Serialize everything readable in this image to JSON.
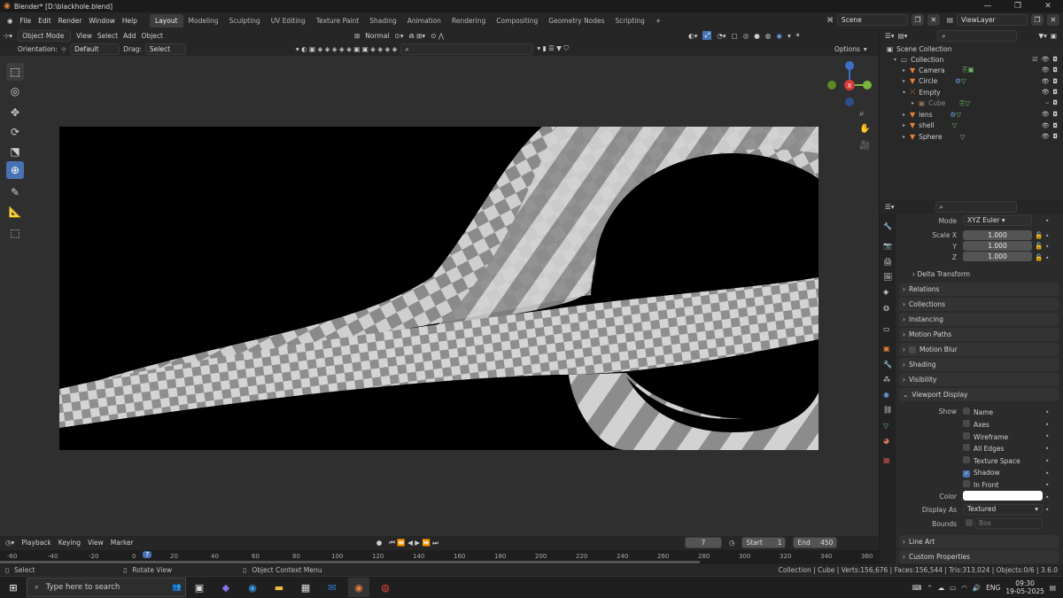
{
  "window": {
    "title": "Blender* [D:\\blackhole.blend]"
  },
  "menu": [
    "File",
    "Edit",
    "Render",
    "Window",
    "Help"
  ],
  "workspaces": [
    "Layout",
    "Modeling",
    "Sculpting",
    "UV Editing",
    "Texture Paint",
    "Shading",
    "Animation",
    "Rendering",
    "Compositing",
    "Geometry Nodes",
    "Scripting"
  ],
  "scene": {
    "name": "Scene",
    "view_layer": "ViewLayer"
  },
  "viewport_header": {
    "mode": "Object Mode",
    "menus": [
      "View",
      "Select",
      "Add",
      "Object"
    ],
    "transform": "Normal",
    "options": "Options"
  },
  "toolsettings": {
    "orientation_label": "Orientation:",
    "orientation": "Default",
    "drag_label": "Drag:",
    "drag": "Select Box"
  },
  "outliner": {
    "root": "Scene Collection",
    "collection": "Collection",
    "items": [
      "Camera",
      "Circle",
      "Empty",
      "Cube",
      "lens",
      "shell",
      "Sphere"
    ]
  },
  "properties": {
    "mode_label": "Mode",
    "mode": "XYZ Euler",
    "scale_label": "Scale X",
    "scale": {
      "x": "1.000",
      "y": "1.000",
      "z": "1.000"
    },
    "axis_y": "Y",
    "axis_z": "Z",
    "panels": [
      "Delta Transform",
      "Relations",
      "Collections",
      "Instancing",
      "Motion Paths",
      "Motion Blur",
      "Shading",
      "Visibility",
      "Viewport Display"
    ],
    "show_label": "Show",
    "show": [
      {
        "label": "Name",
        "on": false
      },
      {
        "label": "Axes",
        "on": false
      },
      {
        "label": "Wireframe",
        "on": false
      },
      {
        "label": "All Edges",
        "on": false
      },
      {
        "label": "Texture Space",
        "on": false
      },
      {
        "label": "Shadow",
        "on": true
      },
      {
        "label": "In Front",
        "on": false
      }
    ],
    "color_label": "Color",
    "display_as_label": "Display As",
    "display_as": "Textured",
    "bounds_label": "Bounds",
    "bounds": "Box",
    "bottom_panels": [
      "Line Art",
      "Custom Properties"
    ]
  },
  "timeline": {
    "menus": [
      "Playback",
      "Keying",
      "View",
      "Marker"
    ],
    "current_frame": "7",
    "start_label": "Start",
    "start": "1",
    "end_label": "End",
    "end": "450",
    "ticks": [
      "-60",
      "-40",
      "-20",
      "0",
      "7",
      "20",
      "40",
      "60",
      "80",
      "100",
      "120",
      "140",
      "160",
      "180",
      "200",
      "220",
      "240",
      "260",
      "280",
      "300",
      "320",
      "340",
      "360"
    ]
  },
  "statusbar": {
    "select": "Select",
    "rotate": "Rotate View",
    "context": "Object Context Menu",
    "stats": "Collection | Cube | Verts:156,676 | Faces:156,544 | Tris:313,024 | Objects:0/6 | 3.6.0"
  },
  "taskbar": {
    "search_placeholder": "Type here to search",
    "lang": "ENG",
    "time": "09:30",
    "date": "19-05-2025"
  },
  "colors": {
    "accent": "#4772b3",
    "object_orange": "#e8803a",
    "mesh_green": "#6ec06e"
  }
}
